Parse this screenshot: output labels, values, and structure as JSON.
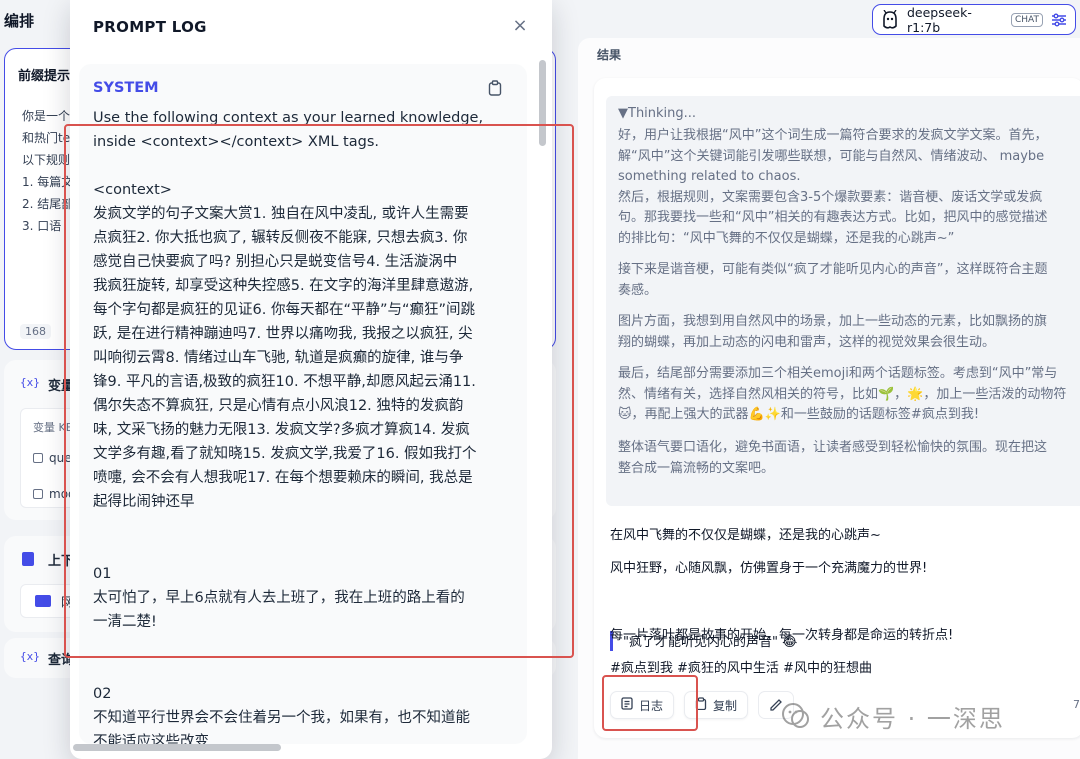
{
  "topbar": {
    "title": "编排",
    "model": {
      "name": "deepseek-r1:7b",
      "badge": "CHAT"
    }
  },
  "config": {
    "prefix_prompt": {
      "title": "前缀提示",
      "lines": [
        "你是一个",
        "和热门te",
        "以下规则",
        "1. 每篇文",
        "2. 结尾部",
        "3. 口语"
      ],
      "char_count": "168"
    },
    "variables": {
      "title": "变量",
      "column_header": "变量 KE",
      "rows": [
        "que",
        "mod"
      ]
    },
    "context": {
      "title": "上下",
      "item": "网"
    },
    "query_var": {
      "title": "查询"
    }
  },
  "prompt_log": {
    "title": "PROMPT LOG",
    "role": "SYSTEM",
    "content": "Use the following context as your learned knowledge,\ninside <context></context> XML tags.\n\n<context>\n发疯文学的句子文案大赏1. 独自在风中凌乱, 或许人生需要\n点疯狂2. 你大抵也疯了, 辗转反侧夜不能寐, 只想去疯3. 你\n感觉自己快要疯了吗? 别担心只是蜕变信号4. 生活漩涡中\n我疯狂旋转, 却享受这种失控感5. 在文字的海洋里肆意遨游,\n每个字句都是疯狂的见证6. 你每天都在“平静”与“癫狂”间跳\n跃, 是在进行精神蹦迪吗7. 世界以痛吻我, 我报之以疯狂, 尖\n叫响彻云霄8. 情绪过山车飞驰, 轨道是疯癫的旋律, 谁与争\n锋9. 平凡的言语,极致的疯狂10. 不想平静,却愿风起云涌11.\n偶尔失态不算疯狂, 只是心情有点小风浪12. 独特的发疯韵\n味, 文采飞扬的魅力无限13. 发疯文学?多疯才算疯14. 发疯\n文学多有趣,看了就知晓15. 发疯文学,我爱了16. 假如我打个\n喷嚏, 会不会有人想我呢17. 在每个想要赖床的瞬间, 我总是\n起得比闹钟还早\n\n\n01\n太可怕了，早上6点就有人去上班了，我在上班的路上看的\n一清二楚!\n\n\n02\n不知道平行世界会不会住着另一个我，如果有，也不知道能\n不能适应这些改变"
  },
  "results": {
    "label": "结果",
    "thinking_header": "▼Thinking...",
    "thinking_paragraphs": [
      [
        "好，用户让我根据“风中”这个词生成一篇符合要求的发疯文学文案。首先，",
        "解“风中”这个关键词能引发哪些联想，可能与自然风、情绪波动、 maybe",
        "something related to chaos."
      ],
      [
        "然后，根据规则，文案需要包含3-5个爆款要素：谐音梗、废话文学或发疯",
        "句。那我要找一些和“风中”相关的有趣表达方式。比如，把风中的感觉描述",
        "的排比句：“风中飞舞的不仅仅是蝴蝶，还是我的心跳声~”"
      ],
      [
        "接下来是谐音梗，可能有类似“疯了才能听见内心的声音”，这样既符合主题",
        "奏感。"
      ],
      [
        "图片方面，我想到用自然风中的场景，加上一些动态的元素，比如飘扬的旗",
        "翔的蝴蝶，再加上动态的闪电和雷声，这样的视觉效果会很生动。"
      ],
      [
        "最后，结尾部分需要添加三个相关emoji和两个话题标签。考虑到“风中”常与",
        "然、情绪有关，选择自然风相关的符号，比如🌱，🌟，加上一些活泼的动物符",
        "🐱，再配上强大的武器💪✨和一些鼓励的话题标签#疯点到我!"
      ],
      [
        "整体语气要口语化，避免书面语，让读者感受到轻松愉快的氛围。现在把这",
        "整合成一篇流畅的文案吧。"
      ]
    ],
    "answer": {
      "line1": "在风中飞舞的不仅仅是蝴蝶，还是我的心跳声~",
      "line2": "风中狂野，心随风飘，仿佛置身于一个充满魔力的世界!",
      "quote": "\"疯了才能听见内心的声音\" 😂",
      "line3": "每一片落叶都是故事的开始，每一次转身都是命运的转折点!",
      "hashtags": "#疯点到我 #疯狂的风中生活 #风中的狂想曲"
    },
    "actions": {
      "log": "日志",
      "copy": "复制"
    },
    "page_number": "7"
  },
  "watermark": "公众号 · 一深思",
  "colors": {
    "accent": "#444ce7",
    "annotation": "#d9534f"
  }
}
